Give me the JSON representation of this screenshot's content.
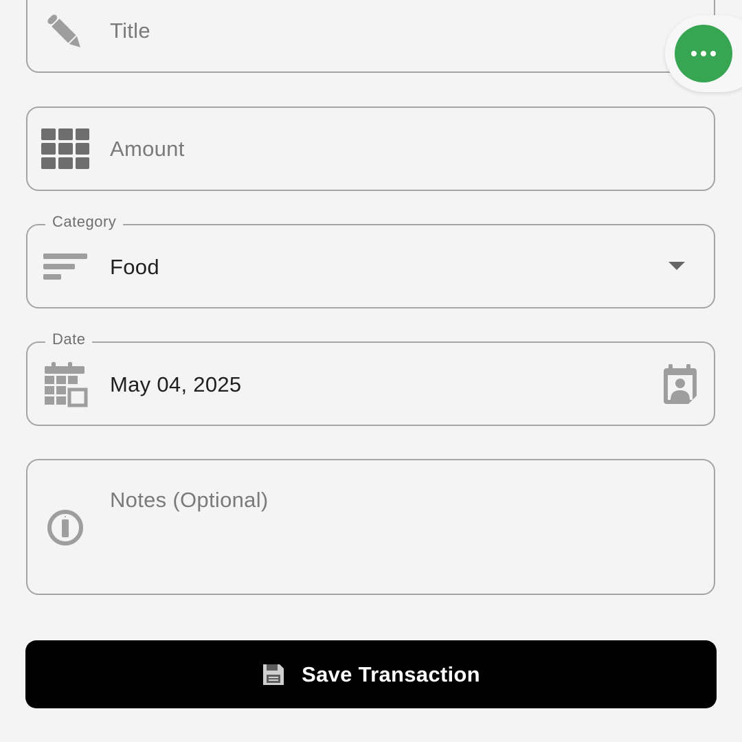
{
  "form": {
    "title": {
      "placeholder": "Title",
      "icon": "pencil-icon"
    },
    "amount": {
      "placeholder": "Amount",
      "icon": "keypad-icon"
    },
    "category": {
      "label": "Category",
      "value": "Food",
      "icon": "sort-icon"
    },
    "date": {
      "label": "Date",
      "value": "May 04, 2025",
      "icon": "calendar-icon",
      "trailing_icon": "calendar-contact-icon"
    },
    "notes": {
      "placeholder": "Notes (Optional)",
      "icon": "info-icon"
    }
  },
  "fab": {
    "icon": "more-horizontal-icon"
  },
  "save_button": {
    "label": "Save Transaction",
    "icon": "save-icon"
  },
  "colors": {
    "background": "#f4f4f4",
    "border": "#a4a4a4",
    "fab": "#37a552",
    "button": "#000000",
    "icon": "#9e9e9e"
  }
}
